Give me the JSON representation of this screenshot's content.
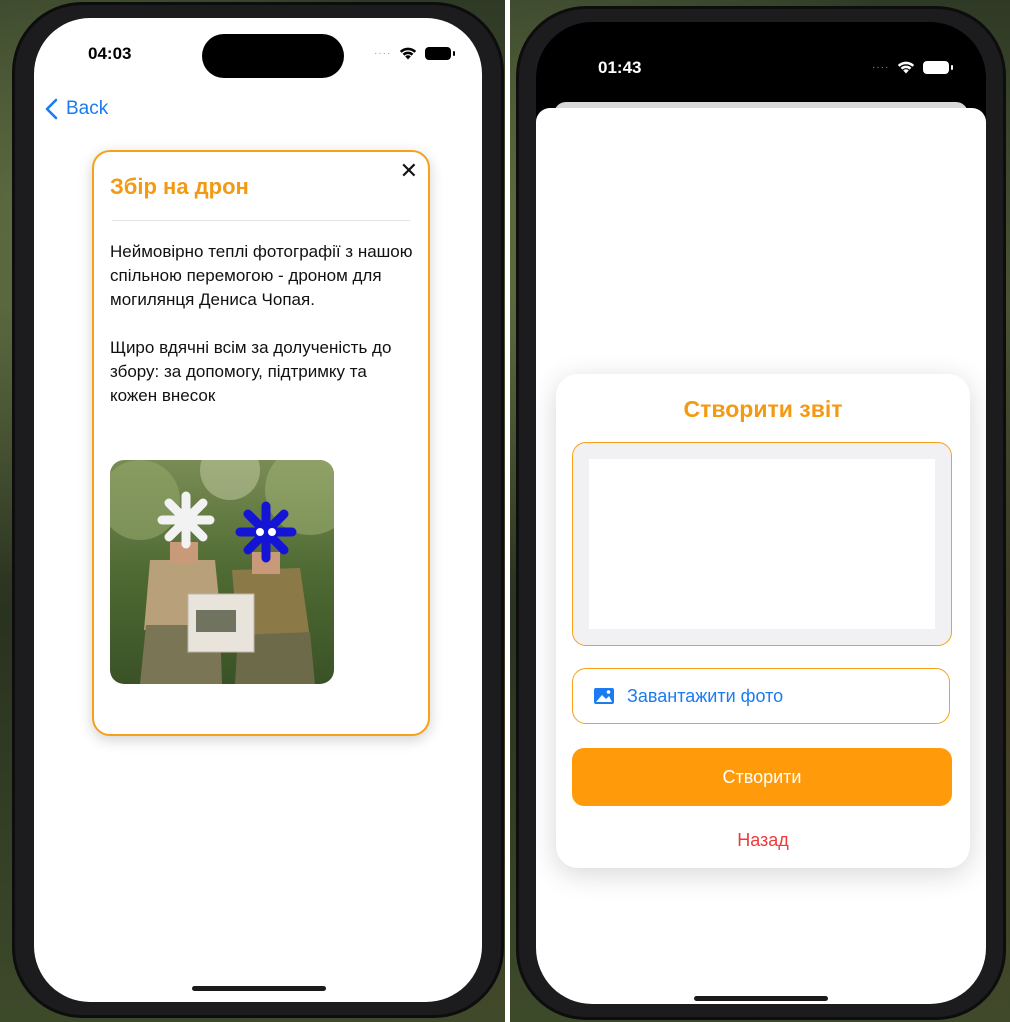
{
  "left_screen": {
    "status": {
      "time": "04:03"
    },
    "nav": {
      "back_label": "Back"
    },
    "card": {
      "title": "Збір на дрон",
      "paragraph1": "Неймовірно теплі фотографії з нашою спільною перемогою - дроном для могилянця Дениса Чопая.",
      "paragraph2": "Щиро вдячні всім за долученість до збору: за допомогу, підтримку та кожен внесок",
      "close_icon": "close-icon",
      "photo": "photo of two soldiers holding a drone box"
    }
  },
  "right_screen": {
    "status": {
      "time": "01:43"
    },
    "modal": {
      "title": "Створити звіт",
      "upload_label": "Завантажити фото",
      "upload_icon": "photo-icon",
      "create_label": "Створити",
      "cancel_label": "Назад"
    }
  },
  "colors": {
    "accent": "#f39a14",
    "button": "#ff9a0a",
    "link": "#1a7bf2",
    "cancel": "#f0393b"
  }
}
